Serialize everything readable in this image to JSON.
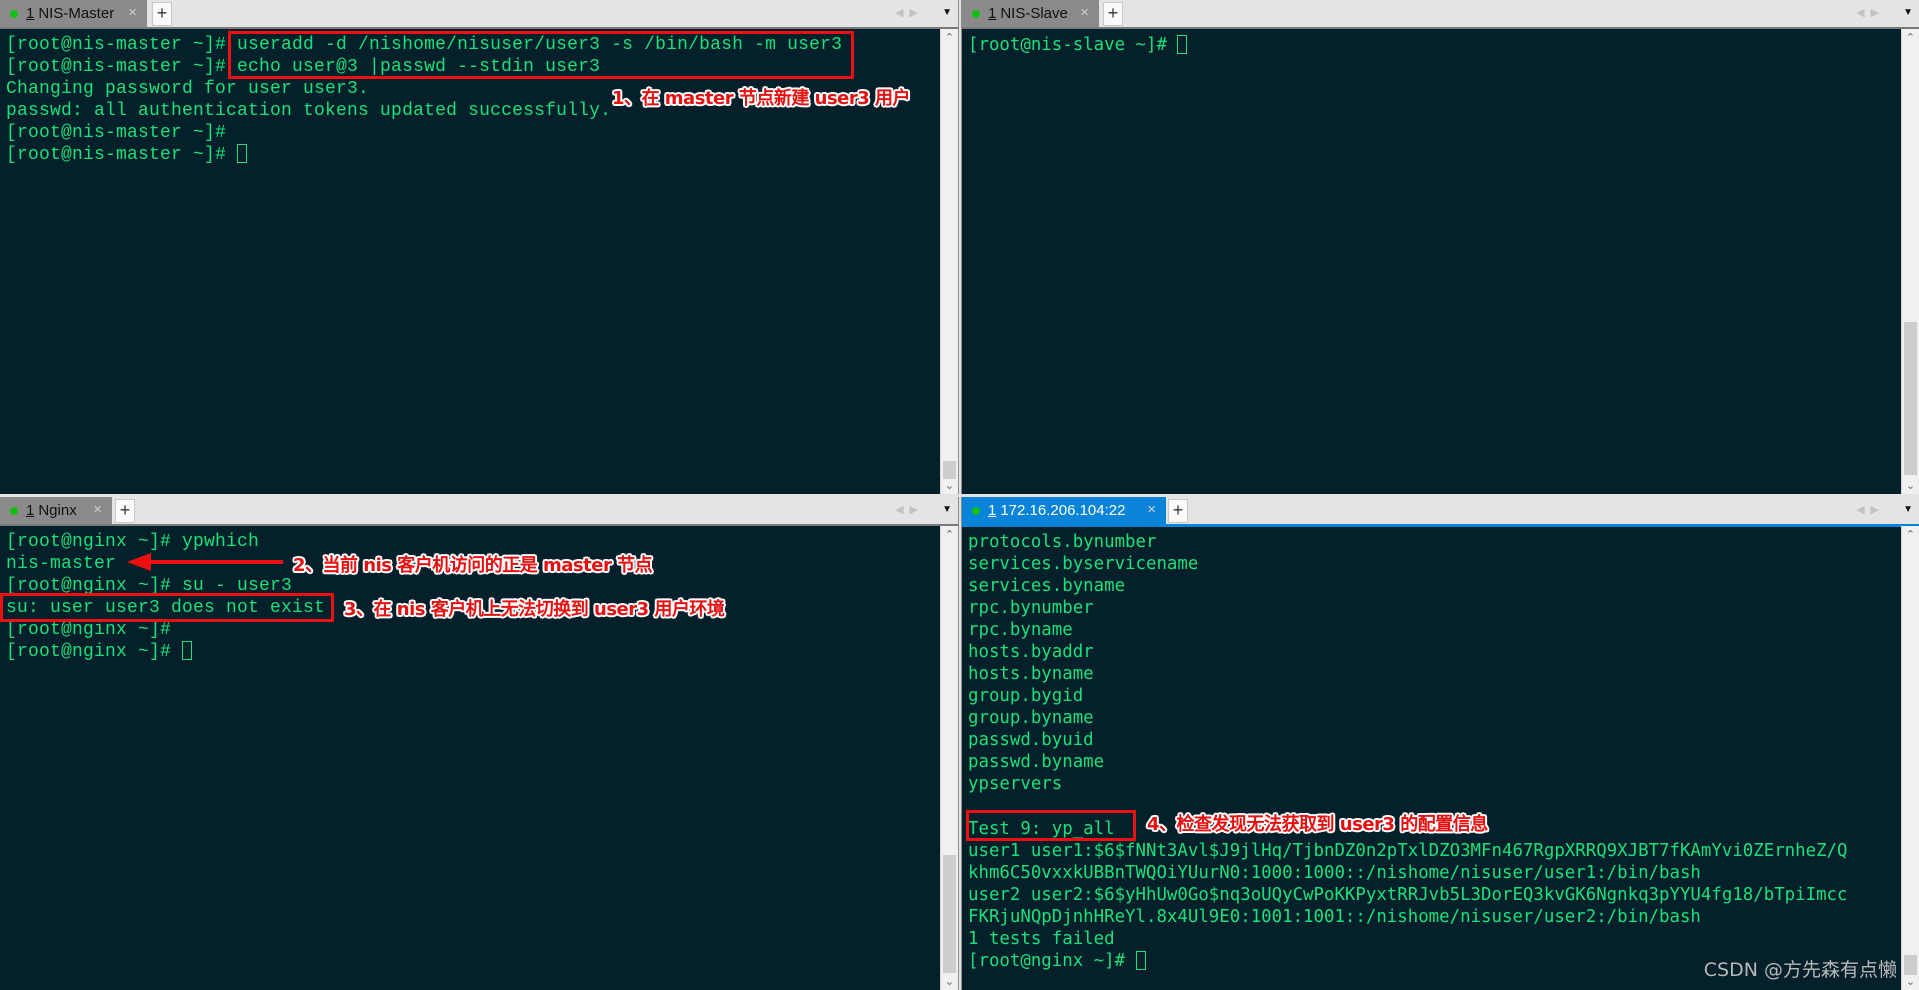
{
  "panes": {
    "top_left": {
      "tab": {
        "number": "1",
        "title": "NIS-Master",
        "status": "connected"
      },
      "lines": [
        "[root@nis-master ~]# useradd -d /nishome/nisuser/user3 -s /bin/bash -m user3",
        "[root@nis-master ~]# echo user@3 |passwd --stdin user3",
        "Changing password for user user3.",
        "passwd: all authentication tokens updated successfully.",
        "[root@nis-master ~]#",
        "[root@nis-master ~]# "
      ],
      "annotation": "1、在 master 节点新建 user3 用户",
      "scroll_position": 1.0
    },
    "top_right": {
      "tab": {
        "number": "1",
        "title": "NIS-Slave",
        "status": "connected"
      },
      "lines": [
        "[root@nis-slave ~]# "
      ],
      "scroll_position": 1.0
    },
    "bottom_left": {
      "tab": {
        "number": "1",
        "title": "Nginx",
        "status": "connected"
      },
      "lines": [
        "[root@nginx ~]# ypwhich",
        "nis-master",
        "[root@nginx ~]# su - user3",
        "su: user user3 does not exist",
        "[root@nginx ~]#",
        "[root@nginx ~]# "
      ],
      "annotation_2": "2、当前 nis 客户机访问的正是 master 节点",
      "annotation_3": "3、在 nis 客户机上无法切换到 user3 用户环境",
      "scroll_position": 1.0
    },
    "bottom_right": {
      "tab": {
        "number": "1",
        "title": "172.16.206.104:22",
        "status": "connected",
        "active": true
      },
      "lines": [
        "protocols.bynumber",
        "services.byservicename",
        "services.byname",
        "rpc.bynumber",
        "rpc.byname",
        "hosts.byaddr",
        "hosts.byname",
        "group.bygid",
        "group.byname",
        "passwd.byuid",
        "passwd.byname",
        "ypservers",
        "",
        "Test 9: yp_all",
        "user1 user1:$6$fNNt3Avl$J9jlHq/TjbnDZ0n2pTxlDZO3MFn467RgpXRRQ9XJBT7fKAmYvi0ZErnheZ/Q",
        "khm6C50vxxkUBBnTWQOiYUurN0:1000:1000::/nishome/nisuser/user1:/bin/bash",
        "user2 user2:$6$yHhUw0Go$nq3oUQyCwPoKKPyxtRRJvb5L3DorEQ3kvGK6Ngnkq3pYYU4fg18/bTpiImcc",
        "FKRjuNQpDjnhHReYl.8x4Ul9E0:1001:1001::/nishome/nisuser/user2:/bin/bash",
        "1 tests failed",
        "[root@nginx ~]# "
      ],
      "annotation": "4、检查发现无法获取到 user3 的配置信息",
      "scroll_position": 1.0
    }
  },
  "icons": {
    "close": "×",
    "new_tab": "+",
    "prev": "◀",
    "next": "▶",
    "menu": "▼",
    "scroll_up": "⌃",
    "scroll_down": "⌄"
  },
  "colors": {
    "terminal_bg": "#04202a",
    "terminal_fg": "#19e07a",
    "annotation_red": "#e51010",
    "active_tab": "#0a84d8",
    "status_dot": "#12c012"
  },
  "watermark": "CSDN @方先森有点懒"
}
